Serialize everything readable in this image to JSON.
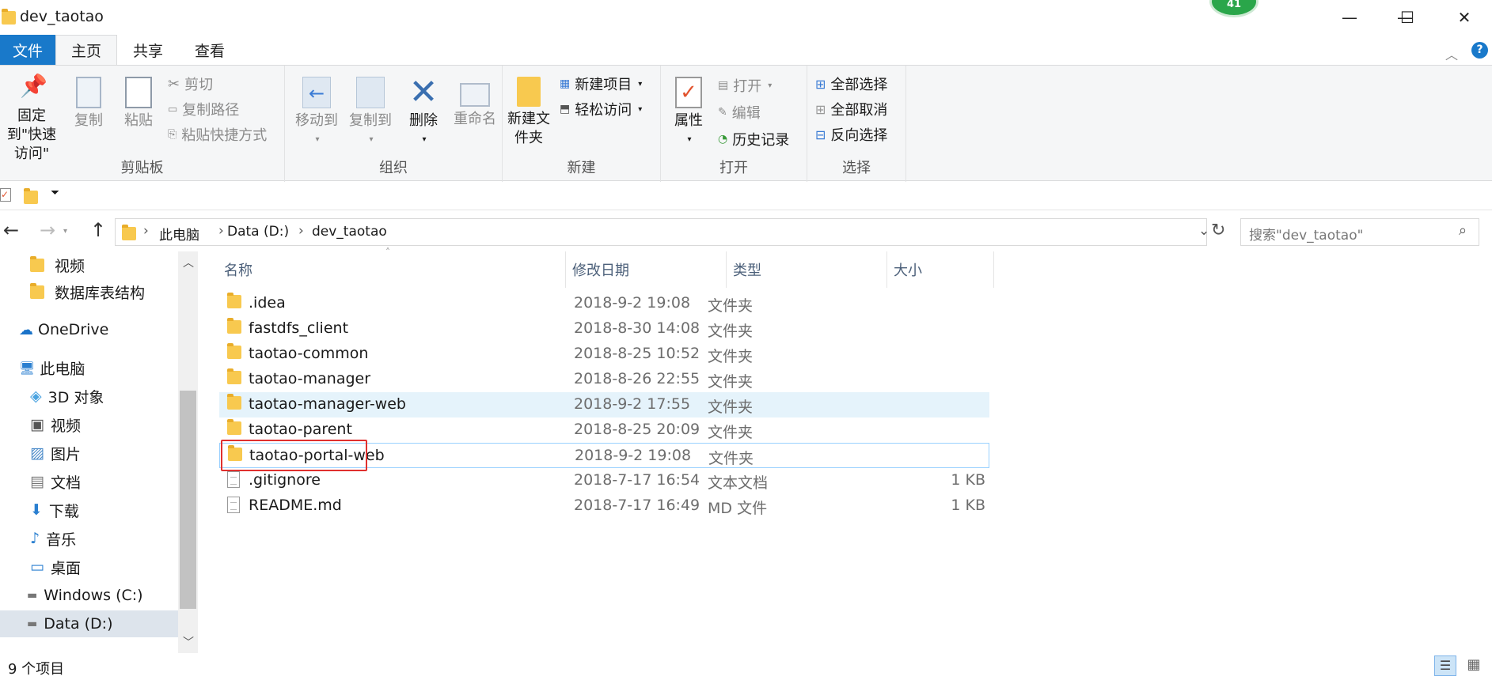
{
  "window": {
    "title": "dev_taotao",
    "badge": "41",
    "minimize": "—",
    "maximize": "☐",
    "close": "✕"
  },
  "tabs": [
    {
      "label": "文件"
    },
    {
      "label": "主页"
    },
    {
      "label": "共享"
    },
    {
      "label": "查看"
    }
  ],
  "ribbon": {
    "clipboard": {
      "group": "剪贴板",
      "pin": "固定到\"快速访问\"",
      "copy": "复制",
      "paste": "粘贴",
      "cut": "剪切",
      "copy_path": "复制路径",
      "paste_shortcut": "粘贴快捷方式"
    },
    "organize": {
      "group": "组织",
      "move_to": "移动到",
      "copy_to": "复制到",
      "delete": "删除",
      "rename": "重命名"
    },
    "new": {
      "group": "新建",
      "new_folder": "新建文件夹",
      "new_item": "新建项目",
      "easy_access": "轻松访问"
    },
    "open": {
      "group": "打开",
      "properties": "属性",
      "open": "打开",
      "edit": "编辑",
      "history": "历史记录"
    },
    "select": {
      "group": "选择",
      "select_all": "全部选择",
      "select_none": "全部取消",
      "invert": "反向选择"
    }
  },
  "address": {
    "crumbs": [
      "此电脑",
      "Data (D:)",
      "dev_taotao"
    ],
    "search_placeholder": "搜索\"dev_taotao\""
  },
  "nav": {
    "items": [
      {
        "label": "视频"
      },
      {
        "label": "数据库表结构"
      },
      {
        "label": "OneDrive"
      },
      {
        "label": "此电脑"
      },
      {
        "label": "3D 对象"
      },
      {
        "label": "视频"
      },
      {
        "label": "图片"
      },
      {
        "label": "文档"
      },
      {
        "label": "下载"
      },
      {
        "label": "音乐"
      },
      {
        "label": "桌面"
      },
      {
        "label": "Windows (C:)"
      },
      {
        "label": "Data (D:)"
      }
    ]
  },
  "columns": {
    "name": "名称",
    "date": "修改日期",
    "type": "类型",
    "size": "大小"
  },
  "files": [
    {
      "name": ".idea",
      "date": "2018-9-2 19:08",
      "type": "文件夹",
      "size": ""
    },
    {
      "name": "fastdfs_client",
      "date": "2018-8-30 14:08",
      "type": "文件夹",
      "size": ""
    },
    {
      "name": "taotao-common",
      "date": "2018-8-25 10:52",
      "type": "文件夹",
      "size": ""
    },
    {
      "name": "taotao-manager",
      "date": "2018-8-26 22:55",
      "type": "文件夹",
      "size": ""
    },
    {
      "name": "taotao-manager-web",
      "date": "2018-9-2 17:55",
      "type": "文件夹",
      "size": ""
    },
    {
      "name": "taotao-parent",
      "date": "2018-8-25 20:09",
      "type": "文件夹",
      "size": ""
    },
    {
      "name": "taotao-portal-web",
      "date": "2018-9-2 19:08",
      "type": "文件夹",
      "size": ""
    },
    {
      "name": ".gitignore",
      "date": "2018-7-17 16:54",
      "type": "文本文档",
      "size": "1 KB"
    },
    {
      "name": "README.md",
      "date": "2018-7-17 16:49",
      "type": "MD 文件",
      "size": "1 KB"
    }
  ],
  "status": {
    "count": "9 个项目"
  }
}
